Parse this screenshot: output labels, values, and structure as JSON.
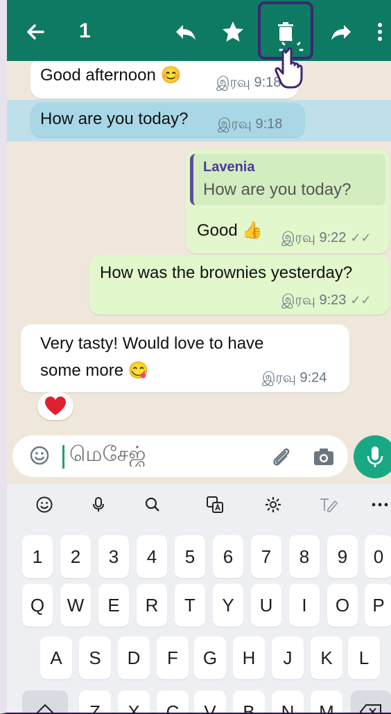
{
  "topbar": {
    "selected_count": "1",
    "icons": [
      "back-arrow-icon",
      "reply-icon",
      "star-icon",
      "delete-icon",
      "forward-icon",
      "more-vert-icon"
    ]
  },
  "messages": [
    {
      "text": "Good afternoon 😊",
      "time": "இரவு 9:18",
      "dir": "in"
    },
    {
      "text": "How are you today?",
      "time": "இரவு 9:18",
      "dir": "in",
      "selected": true
    },
    {
      "quote_name": "Lavenia",
      "quote_text": "How are you today?",
      "text": "Good 👍",
      "time": "இரவு 9:22",
      "status": "✓✓",
      "dir": "out"
    },
    {
      "text": "How was the brownies yesterday?",
      "time": "இரவு 9:23",
      "status": "✓✓",
      "dir": "out"
    },
    {
      "text_line1": "Very tasty! Would love to have",
      "text_line2": "some more 😋",
      "time": "இரவு 9:24",
      "dir": "in",
      "reaction": "❤️"
    }
  ],
  "input": {
    "placeholder": "மெசேஜ்"
  },
  "keyboard": {
    "numbers": [
      "1",
      "2",
      "3",
      "4",
      "5",
      "6",
      "7",
      "8",
      "9",
      "0"
    ],
    "row1": [
      "Q",
      "W",
      "E",
      "R",
      "T",
      "Y",
      "U",
      "I",
      "O",
      "P"
    ],
    "row2": [
      "A",
      "S",
      "D",
      "F",
      "G",
      "H",
      "J",
      "K",
      "L"
    ],
    "row3": [
      "Z",
      "X",
      "C",
      "V",
      "B",
      "N",
      "M"
    ]
  },
  "colors": {
    "header": "#0f7a64",
    "accent": "#18a884",
    "incoming": "#ffffff",
    "outgoing": "#e2f7cb",
    "selection": "#bfe0ea",
    "highlight_box": "#3d2670"
  }
}
